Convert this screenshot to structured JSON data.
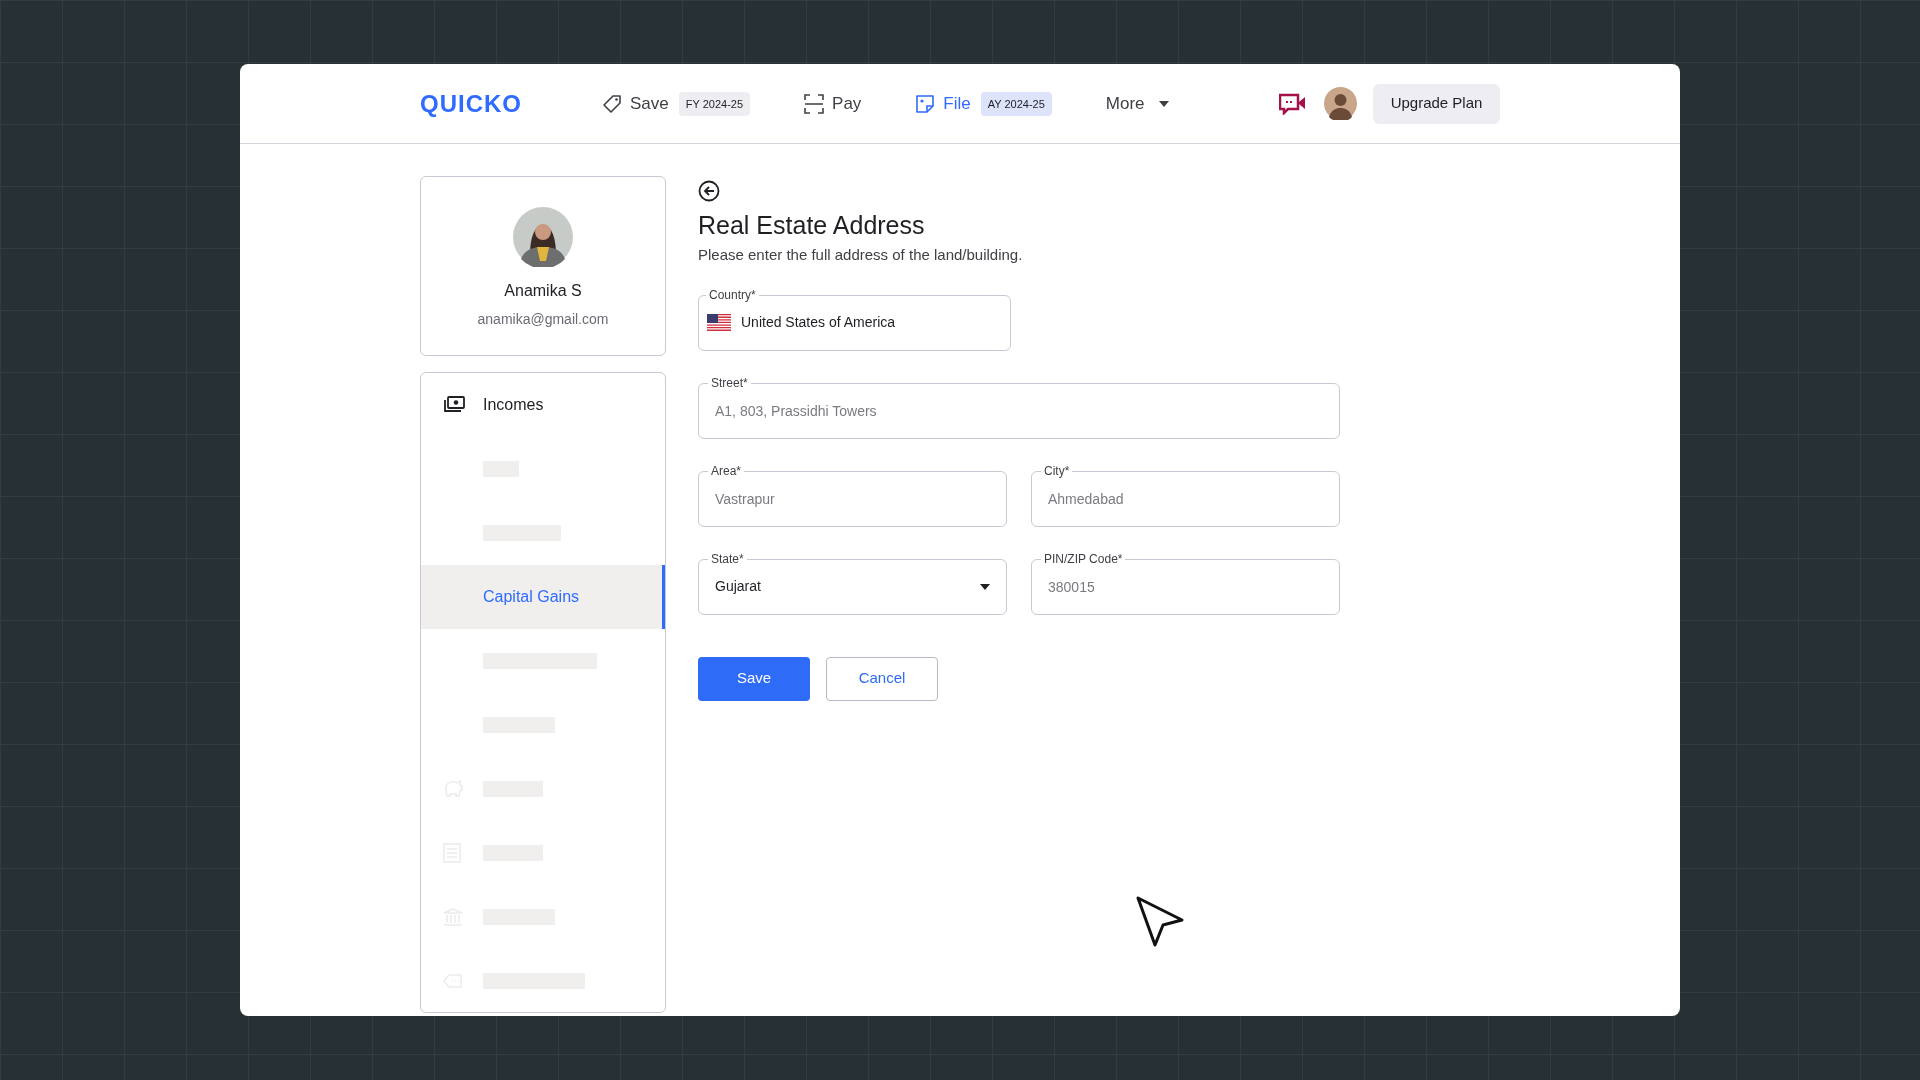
{
  "logo": "QUICKO",
  "nav": [
    {
      "kind": "tag",
      "label": "Save",
      "badge": "FY 2024-25",
      "selected": false
    },
    {
      "kind": "scan",
      "label": "Pay",
      "selected": false
    },
    {
      "kind": "note",
      "label": "File",
      "badge": "AY 2024-25",
      "selected": true
    },
    {
      "kind": "menu",
      "label": "More",
      "selected": false
    }
  ],
  "upgrade_button": "Upgrade Plan",
  "profile": {
    "name": "Anamika S",
    "email": "anamika@gmail.com"
  },
  "sidebar": {
    "items": [
      {
        "kind": "heading",
        "label": "Incomes",
        "selected": false
      },
      {
        "kind": "placeholder",
        "selected": false
      },
      {
        "kind": "placeholder",
        "selected": false
      },
      {
        "kind": "link",
        "label": "Capital Gains",
        "selected": true
      },
      {
        "kind": "placeholder",
        "selected": false
      },
      {
        "kind": "placeholder",
        "selected": false
      },
      {
        "kind": "placeholder",
        "selected": false
      },
      {
        "kind": "placeholder",
        "selected": false
      },
      {
        "kind": "placeholder",
        "selected": false
      },
      {
        "kind": "placeholder",
        "selected": false
      }
    ]
  },
  "form": {
    "title": "Real Estate Address",
    "subtitle": "Please enter the full address of the land/building.",
    "fields": [
      {
        "kind": "country",
        "label": "Country*",
        "value": "United States of America"
      },
      {
        "kind": "text",
        "label": "Street*",
        "placeholder": "A1, 803, Prassidhi Towers"
      },
      {
        "kind": "text",
        "label": "Area*",
        "placeholder": "Vastrapur"
      },
      {
        "kind": "text",
        "label": "City*",
        "placeholder": "Ahmedabad"
      },
      {
        "kind": "select",
        "label": "State*",
        "value": "Gujarat"
      },
      {
        "kind": "text",
        "label": "PIN/ZIP Code*",
        "placeholder": "380015"
      }
    ],
    "buttons": [
      {
        "kind": "primary",
        "label": "Save"
      },
      {
        "kind": "secondary",
        "label": "Cancel"
      }
    ]
  }
}
